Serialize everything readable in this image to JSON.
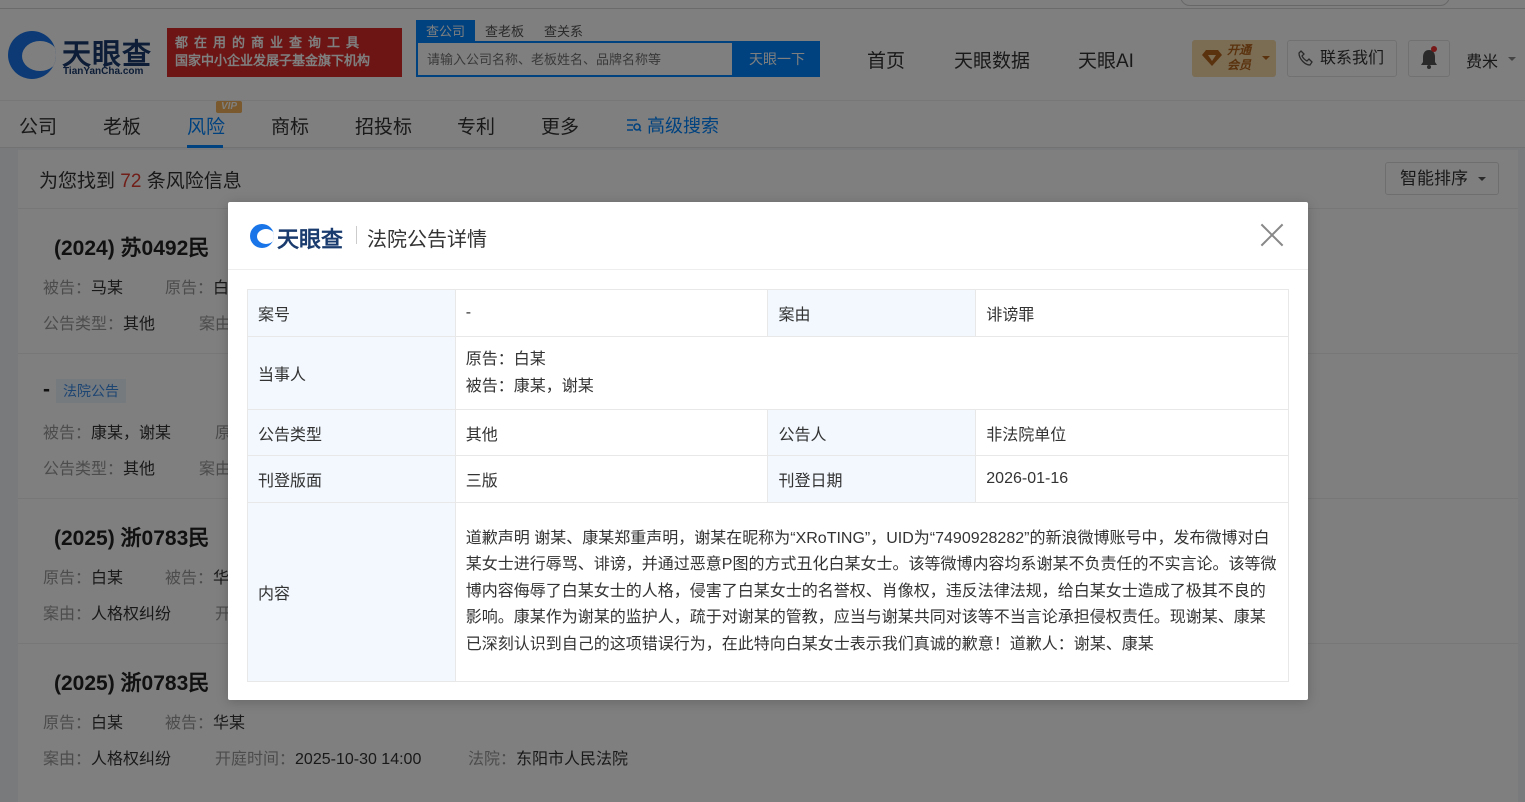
{
  "header": {
    "logo_cn": "天眼查",
    "logo_en": "TianYanCha.com",
    "slogan_line1": "都在用的商业查询工具",
    "slogan_line2": "国家中小企业发展子基金旗下机构",
    "search_tabs": [
      "查公司",
      "查老板",
      "查关系"
    ],
    "search_placeholder": "请输入公司名称、老板姓名、品牌名称等",
    "search_button": "天眼一下",
    "nav": [
      "首页",
      "天眼数据",
      "天眼AI"
    ],
    "vip_line1": "开通",
    "vip_line2": "会员",
    "contact": "联系我们",
    "user": "费米"
  },
  "categories": {
    "items": [
      "公司",
      "老板",
      "风险",
      "商标",
      "招投标",
      "专利",
      "更多"
    ],
    "active": "风险",
    "vip_tag": "VIP",
    "advanced": "高级搜索"
  },
  "results": {
    "prefix": "为您找到",
    "count": "72",
    "suffix": "条风险信息",
    "sort": "智能排序",
    "items": [
      {
        "title": "(2024) 苏0492民",
        "line1": [
          [
            "被告：",
            "马某"
          ],
          [
            "原告：",
            "白"
          ]
        ],
        "line2": [
          [
            "公告类型：",
            "其他"
          ],
          [
            "案由",
            ""
          ]
        ]
      },
      {
        "title": "-",
        "tag": "法院公告",
        "line1": [
          [
            "被告：",
            "康某，谢某"
          ],
          [
            "原",
            ""
          ]
        ],
        "line2": [
          [
            "公告类型：",
            "其他"
          ],
          [
            "案由",
            ""
          ]
        ]
      },
      {
        "title": "(2025) 浙0783民",
        "line1": [
          [
            "原告：",
            "白某"
          ],
          [
            "被告：",
            "华"
          ]
        ],
        "line2": [
          [
            "案由：",
            "人格权纠纷"
          ],
          [
            "开",
            ""
          ]
        ]
      },
      {
        "title": "(2025) 浙0783民",
        "line1": [
          [
            "原告：",
            "白某"
          ],
          [
            "被告：",
            "华某"
          ]
        ],
        "line2": [
          [
            "案由：",
            "人格权纠纷"
          ],
          [
            "开庭时间：",
            "2025-10-30 14:00"
          ],
          [
            "法院：",
            "东阳市人民法院"
          ]
        ]
      }
    ]
  },
  "modal": {
    "logo": "天眼查",
    "title": "法院公告详情",
    "rows": {
      "case_no_label": "案号",
      "case_no": "-",
      "cause_label": "案由",
      "cause": "诽谤罪",
      "parties_label": "当事人",
      "plaintiff": "原告：白某",
      "defendant": "被告：康某，谢某",
      "type_label": "公告类型",
      "type": "其他",
      "announcer_label": "公告人",
      "announcer": "非法院单位",
      "section_label": "刊登版面",
      "section": "三版",
      "date_label": "刊登日期",
      "date": "2026-01-16",
      "content_label": "内容",
      "content": "道歉声明 谢某、康某郑重声明，谢某在昵称为“XRoTING”，UID为“7490928282”的新浪微博账号中，发布微博对白某女士进行辱骂、诽谤，并通过恶意P图的方式丑化白某女士。该等微博内容均系谢某不负责任的不实言论。该等微博内容侮辱了白某女士的人格，侵害了白某女士的名誉权、肖像权，违反法律法规，给白某女士造成了极其不良的影响。康某作为谢某的监护人，疏于对谢某的管教，应当与谢某共同对该等不当言论承担侵权责任。现谢某、康某已深刻认识到自己的这项错误行为，在此特向白某女士表示我们真诚的歉意！道歉人：谢某、康某"
    }
  },
  "colors": {
    "brand_blue": "#0084ff",
    "slogan_red": "#d82b28",
    "count_red": "#e23b30",
    "vip_gold": "#f7d9a8"
  }
}
